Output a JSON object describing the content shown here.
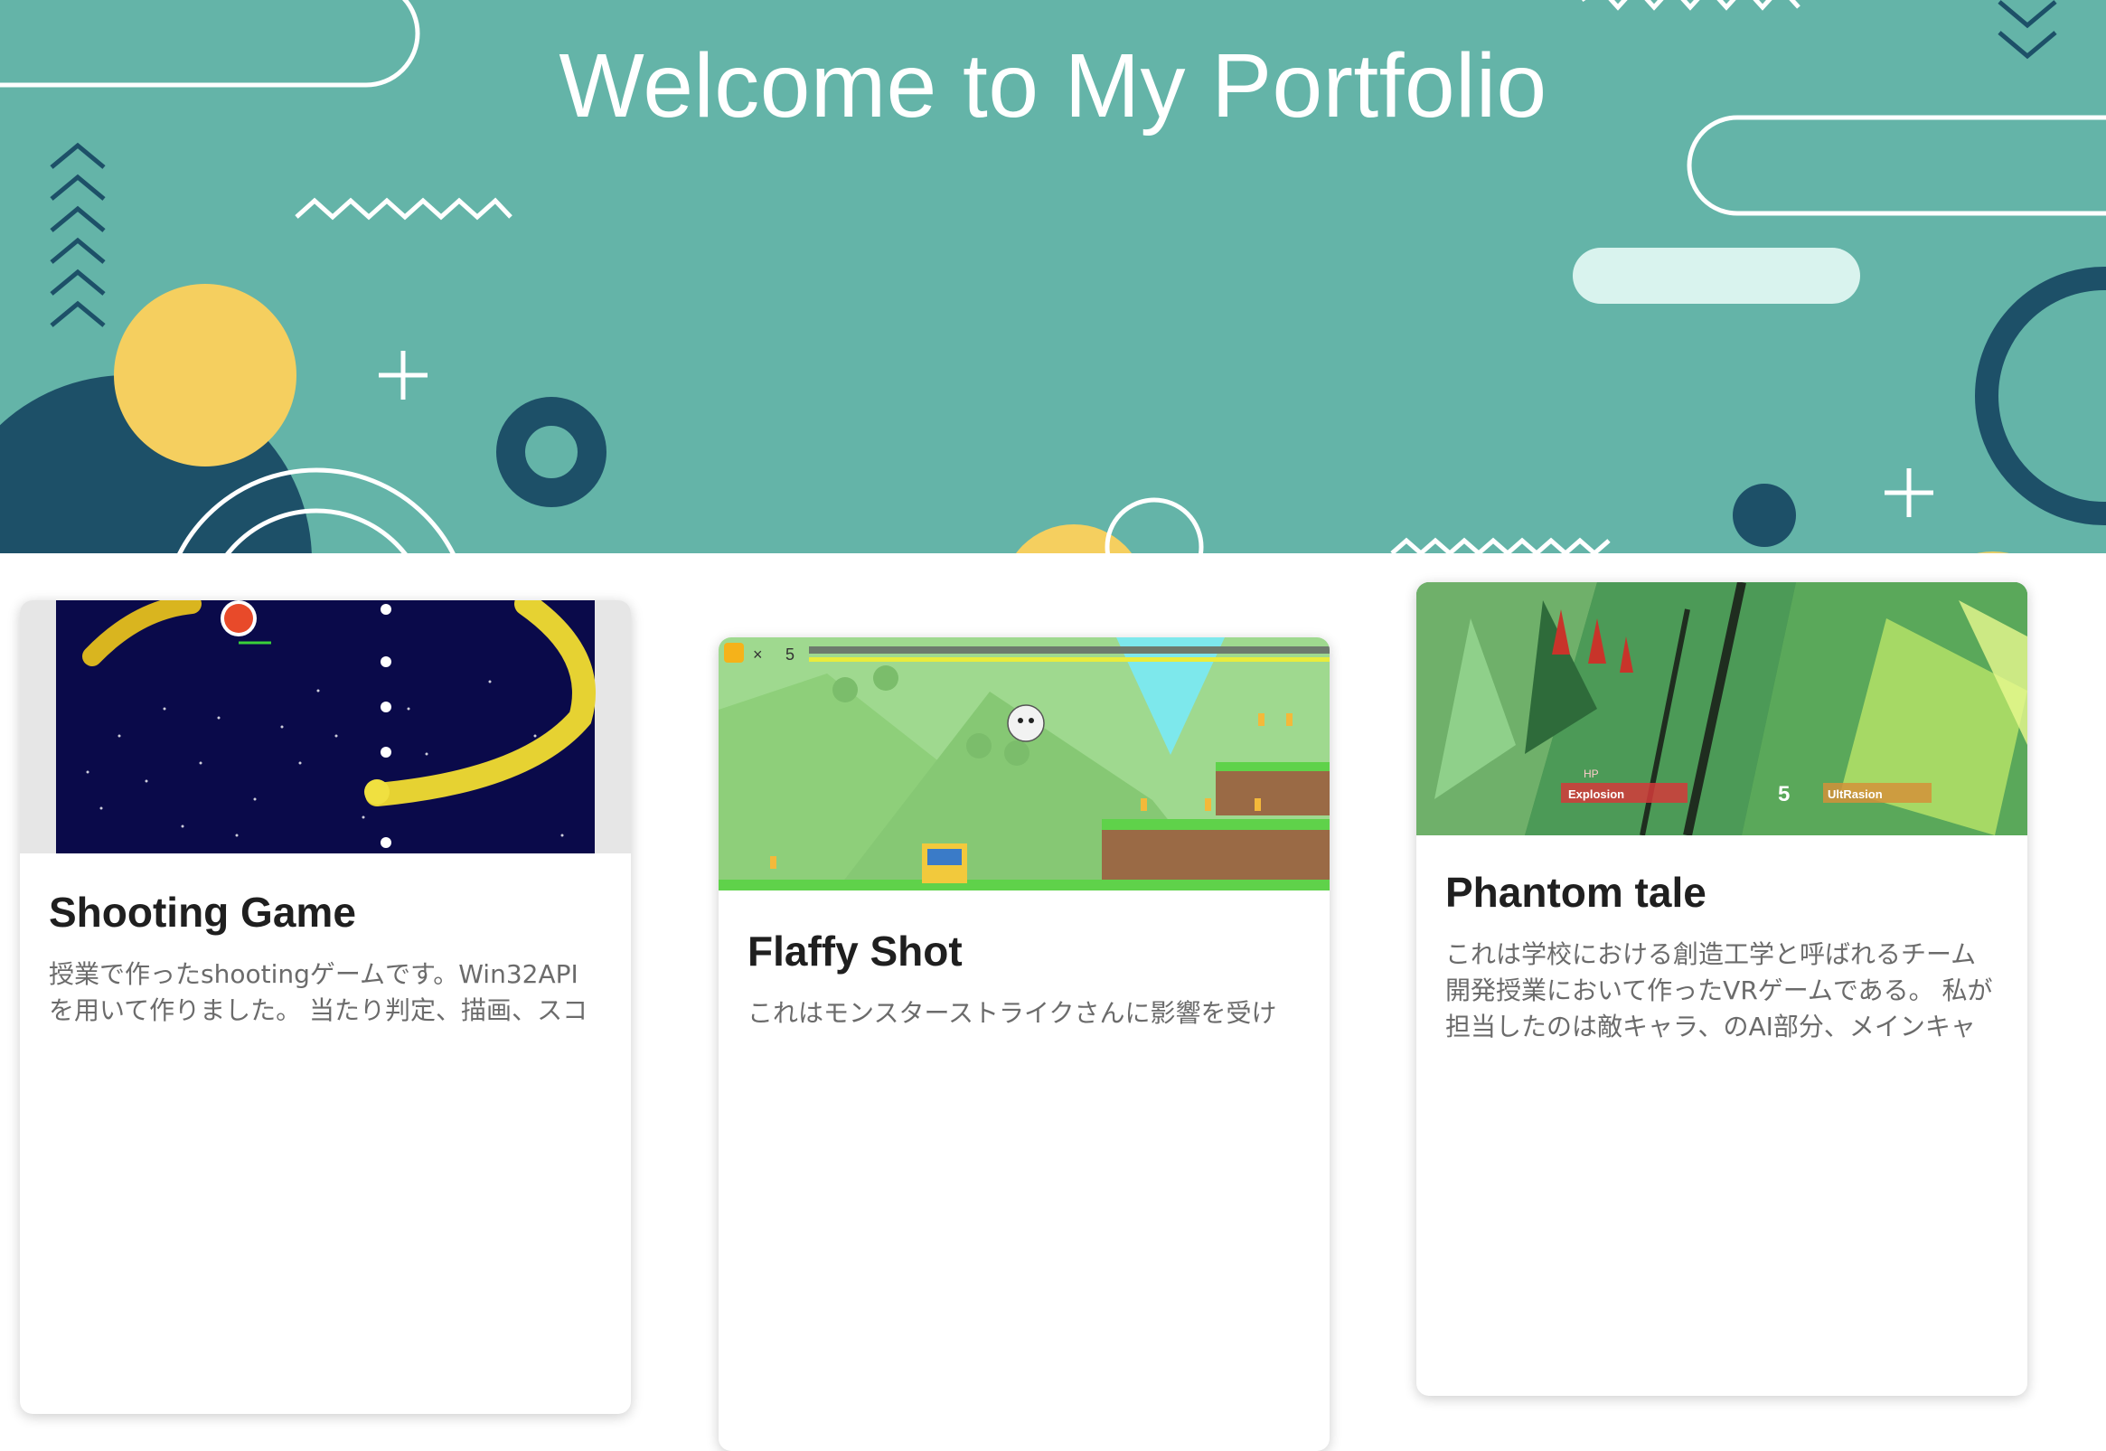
{
  "header": {
    "title": "Welcome to My Portfolio"
  },
  "colors": {
    "hero_bg": "#64b4a8",
    "dark_teal": "#1d5068",
    "yellow": "#f5cf5f",
    "mint": "#d9f3ee",
    "white": "#ffffff"
  },
  "projects": [
    {
      "title": "Shooting Game",
      "description": "授業で作ったshootingゲームです。Win32APIを用いて作りました。 当たり判定、描画、スコ",
      "thumbnail_icon": "shooting-game-screenshot"
    },
    {
      "title": "Flaffy Shot",
      "description": "これはモンスターストライクさんに影響を受け",
      "thumbnail_icon": "flaffy-shot-screenshot",
      "hud": {
        "coin_count": "5",
        "multiplier": "×"
      }
    },
    {
      "title": "Phantom tale",
      "description": "これは学校における創造工学と呼ばれるチーム開発授業において作ったVRゲームである。 私が担当したのは敵キャラ、のAI部分、メインキャ",
      "thumbnail_icon": "phantom-tale-screenshot",
      "hud": {
        "hp": "HP",
        "skill_left": "Explosion",
        "count": "5",
        "skill_right": "UltRasion"
      }
    }
  ]
}
